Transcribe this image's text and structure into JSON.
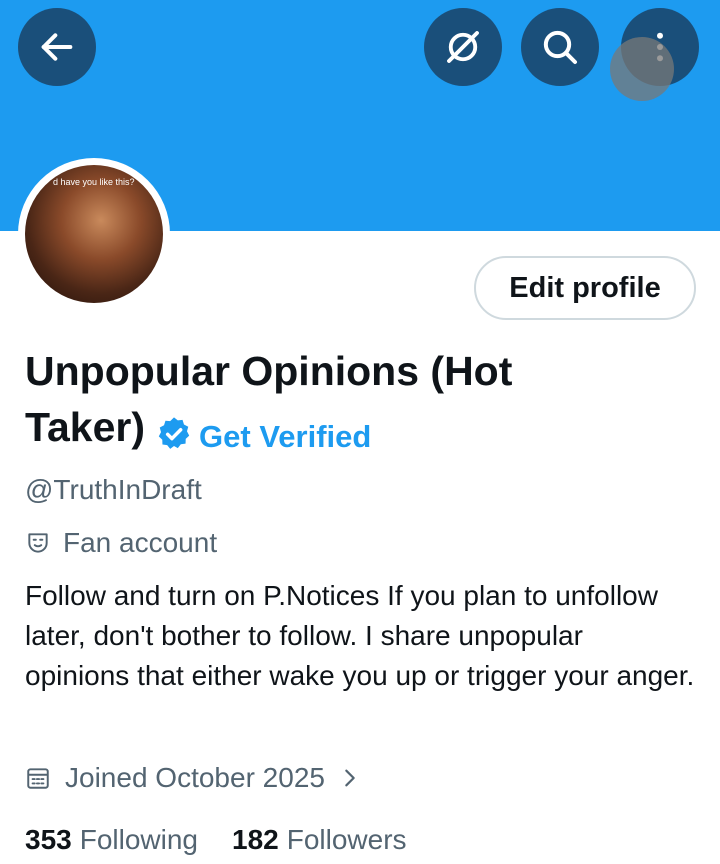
{
  "header": {
    "back_icon": "arrow-left-icon",
    "grok_icon": "grok-icon",
    "search_icon": "search-icon",
    "more_icon": "more-vertical-icon",
    "banner_color": "#1d9bf0"
  },
  "profile": {
    "avatar_caption": "d have you like this?",
    "edit_profile_label": "Edit profile",
    "display_name": "Unpopular Opinions (Hot Taker)",
    "get_verified_label": "Get Verified",
    "handle": "@TruthInDraft",
    "category": "Fan account",
    "bio": "Follow and turn on P.Notices  If you plan to unfollow later, don't bother to follow.  I share unpopular opinions that either wake you up or trigger your anger.",
    "joined": "Joined October 2025"
  },
  "stats": {
    "following_count": "353",
    "following_label": "Following",
    "followers_count": "182",
    "followers_label": "Followers"
  }
}
